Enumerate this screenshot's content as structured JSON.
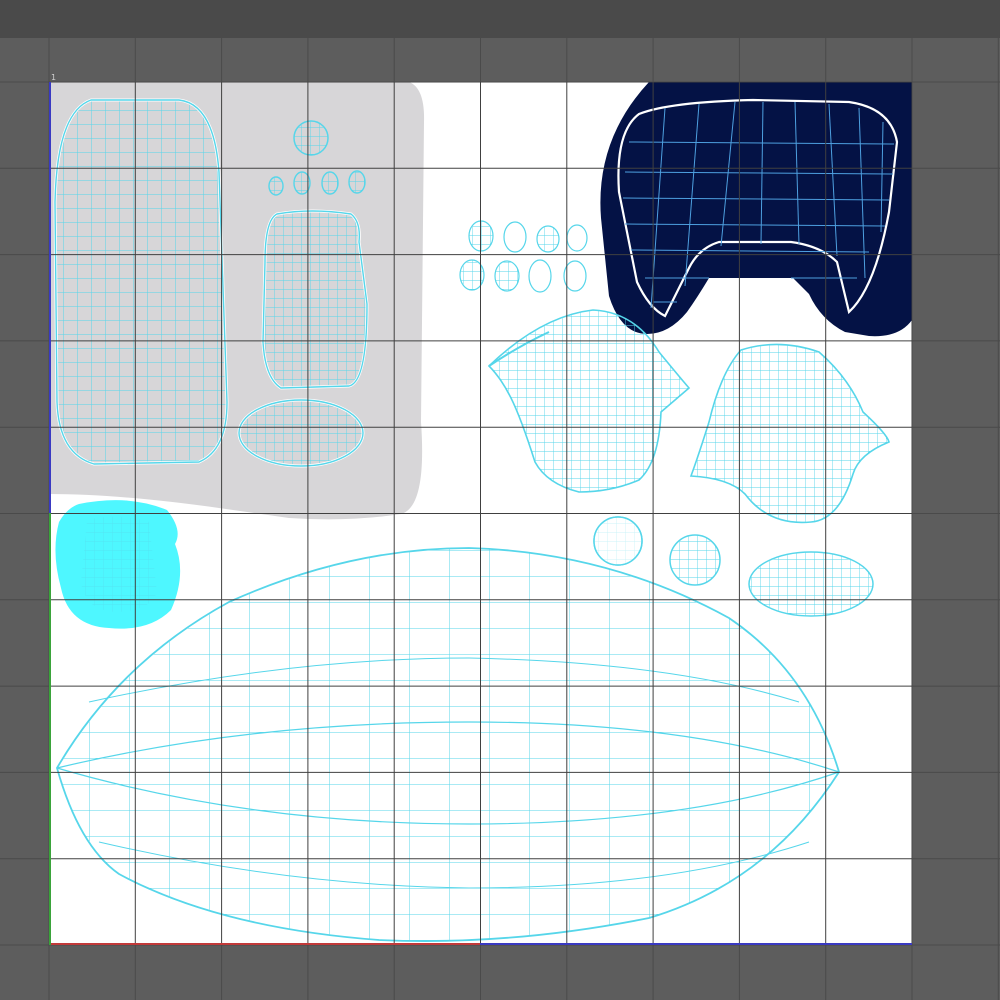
{
  "window": {
    "toolbar_label": ""
  },
  "uv_editor": {
    "grid_divisions": 10,
    "origin_label": "1",
    "colors": {
      "background_outside": "#5d5d5d",
      "uv_space": "#ffffff",
      "grid_line": "#404040",
      "wire": "#56d6ea",
      "shell_gray": "#d7d6d8",
      "shell_navy": "#041245",
      "shell_cyan": "#4ef7ff",
      "u_axis": "#c23a3a",
      "v_axis": "#3aa33a"
    },
    "shells": [
      {
        "name": "large-tall-shell"
      },
      {
        "name": "small-round-shell"
      },
      {
        "name": "toe-shells"
      },
      {
        "name": "medium-tall-shell"
      },
      {
        "name": "oval-shell"
      },
      {
        "name": "small-ovals-cluster"
      },
      {
        "name": "navy-u-shell"
      },
      {
        "name": "center-cup-shell"
      },
      {
        "name": "right-cup-shell"
      },
      {
        "name": "cyan-shell"
      },
      {
        "name": "small-circle-shell-1"
      },
      {
        "name": "small-circle-shell-2"
      },
      {
        "name": "small-oval-shell-right"
      },
      {
        "name": "large-lens-shell"
      }
    ]
  }
}
